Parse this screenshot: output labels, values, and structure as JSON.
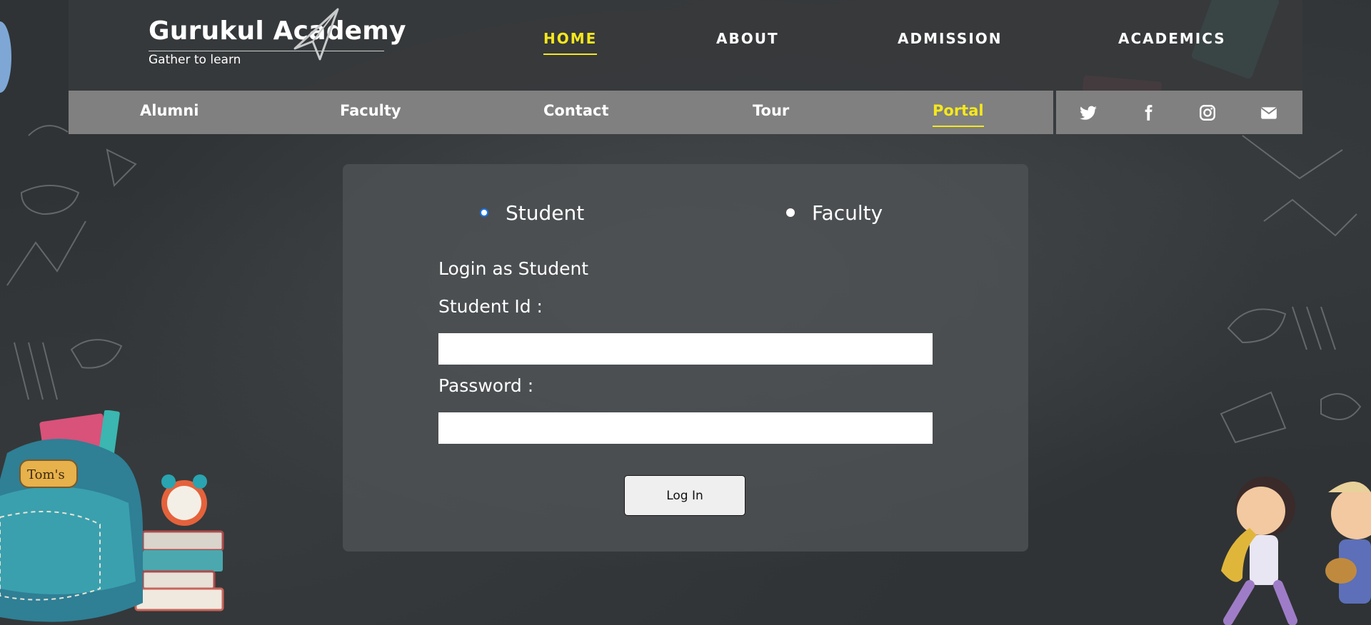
{
  "brand": {
    "title": "Gurukul Academy",
    "tagline": "Gather to learn"
  },
  "main_nav": [
    {
      "label": "HOME",
      "active": true
    },
    {
      "label": "ABOUT",
      "active": false
    },
    {
      "label": "ADMISSION",
      "active": false
    },
    {
      "label": "ACADEMICS",
      "active": false
    }
  ],
  "sub_nav": [
    {
      "label": "Alumni",
      "active": false
    },
    {
      "label": "Faculty",
      "active": false
    },
    {
      "label": "Contact",
      "active": false
    },
    {
      "label": "Tour",
      "active": false
    },
    {
      "label": "Portal",
      "active": true
    }
  ],
  "social": [
    "twitter-icon",
    "facebook-icon",
    "instagram-icon",
    "envelope-icon"
  ],
  "login": {
    "roles": [
      {
        "label": "Student",
        "selected": true
      },
      {
        "label": "Faculty",
        "selected": false
      }
    ],
    "heading": "Login as Student",
    "id_label": "Student Id :",
    "id_value": "",
    "password_label": "Password :",
    "password_value": "",
    "button_label": "Log In"
  },
  "decor": {
    "backpack_tag": "Tom's"
  },
  "colors": {
    "accent": "#f5e81b",
    "radio_accent": "#1a73e8",
    "nav_bar": "#808080",
    "header": "#373a3c"
  }
}
